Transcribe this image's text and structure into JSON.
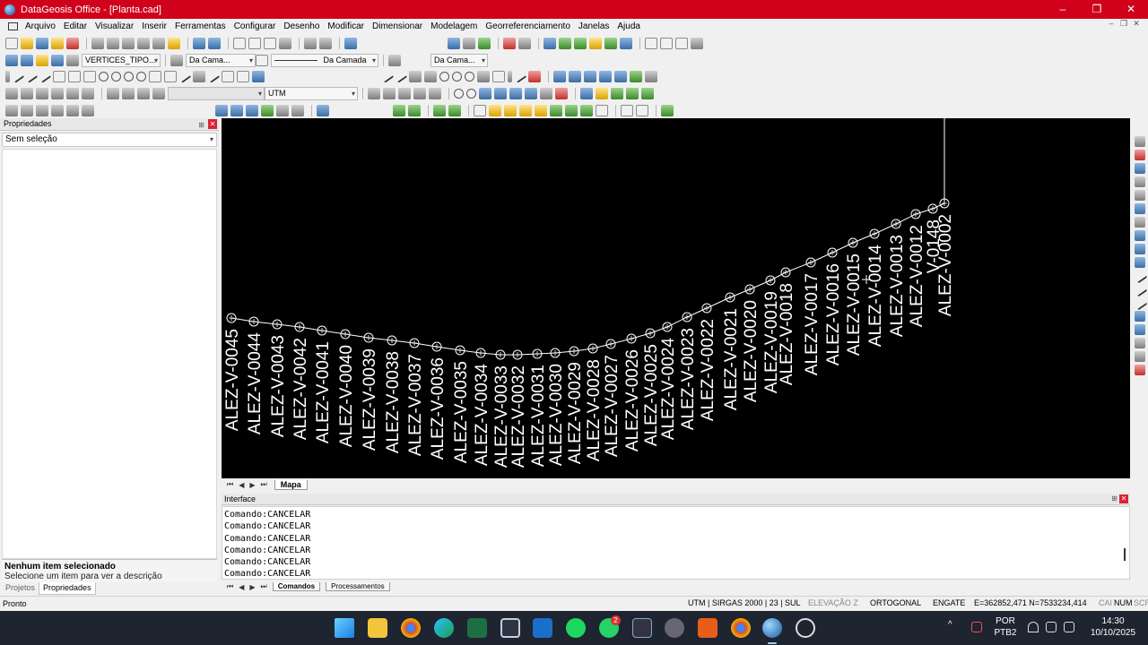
{
  "window": {
    "title": "DataGeosis Office - [Planta.cad]",
    "controls": [
      "–",
      "❐",
      "✕"
    ]
  },
  "menu": [
    "Arquivo",
    "Editar",
    "Visualizar",
    "Inserir",
    "Ferramentas",
    "Configurar",
    "Desenho",
    "Modificar",
    "Dimensionar",
    "Modelagem",
    "Georreferenciamento",
    "Janelas",
    "Ajuda"
  ],
  "toolbar": {
    "layer_combo": "VERTICES_TIPO...",
    "linecolor_combo": "Da Cama...",
    "linetype_combo": "Da Camada",
    "lineweight_combo": "Da Cama...",
    "projection_combo": "UTM"
  },
  "panels": {
    "properties": {
      "title": "Propriedades",
      "selection": "Sem seleção",
      "desc_title": "Nenhum item selecionado",
      "desc_text": "Selecione um item para ver a descrição",
      "tabs": [
        "Projetos",
        "Propriedades"
      ]
    },
    "interface": {
      "title": "Interface",
      "lines": [
        "Comando:CANCELAR",
        "Comando:CANCELAR",
        "Comando:CANCELAR",
        "Comando:CANCELAR",
        "Comando:CANCELAR",
        "Comando:CANCELAR"
      ],
      "tabs": [
        "Comandos",
        "Processamentos"
      ]
    }
  },
  "canvas": {
    "sheet_tab": "Mapa",
    "vertex_labels": [
      "ALEZ-V-0045",
      "ALEZ-V-0044",
      "ALEZ-V-0043",
      "ALEZ-V-0042",
      "ALEZ-V-0041",
      "ALEZ-V-0040",
      "ALEZ-V-0039",
      "ALEZ-V-0038",
      "ALEZ-V-0037",
      "ALEZ-V-0036",
      "ALEZ-V-0035",
      "ALEZ-V-0034",
      "ALEZ-V-0033",
      "ALEZ-V-0032",
      "ALEZ-V-0031",
      "ALEZ-V-0030",
      "ALEZ-V-0029",
      "ALEZ-V-0028",
      "ALEZ-V-0027",
      "ALEZ-V-0026",
      "ALEZ-V-0025",
      "ALEZ-V-0024",
      "ALEZ-V-0023",
      "ALEZ-V-0022",
      "ALEZ-V-0021",
      "ALEZ-V-0020",
      "ALEZ-V-0019",
      "ALEZ-V-0018",
      "ALEZ-V-0017",
      "ALEZ-V-0016",
      "ALEZ-V-0015",
      "ALEZ-V-0014",
      "ALEZ-V-0013",
      "ALEZ-V-0012",
      "V-0148",
      "ALEZ-V-0002"
    ]
  },
  "status": {
    "ready": "Pronto",
    "crs": "UTM | SIRGAS 2000 | 23 | SUL",
    "elevation": "ELEVAÇÃO Z",
    "ortho": "ORTOGONAL",
    "snap": "ENGATE",
    "coords": "E=362852,471 N=7533234,414",
    "caps": "CAI",
    "num": "NUM",
    "scr": "SCR"
  },
  "taskbar": {
    "language": "POR",
    "layout": "PTB2",
    "time": "14:30",
    "date": "10/10/2025",
    "whatsapp_badge": "2"
  },
  "colors": {
    "titlebar": "#d0021b",
    "canvas_bg": "#000000",
    "drawing": "#ffffff",
    "taskbar": "#1e2430"
  }
}
